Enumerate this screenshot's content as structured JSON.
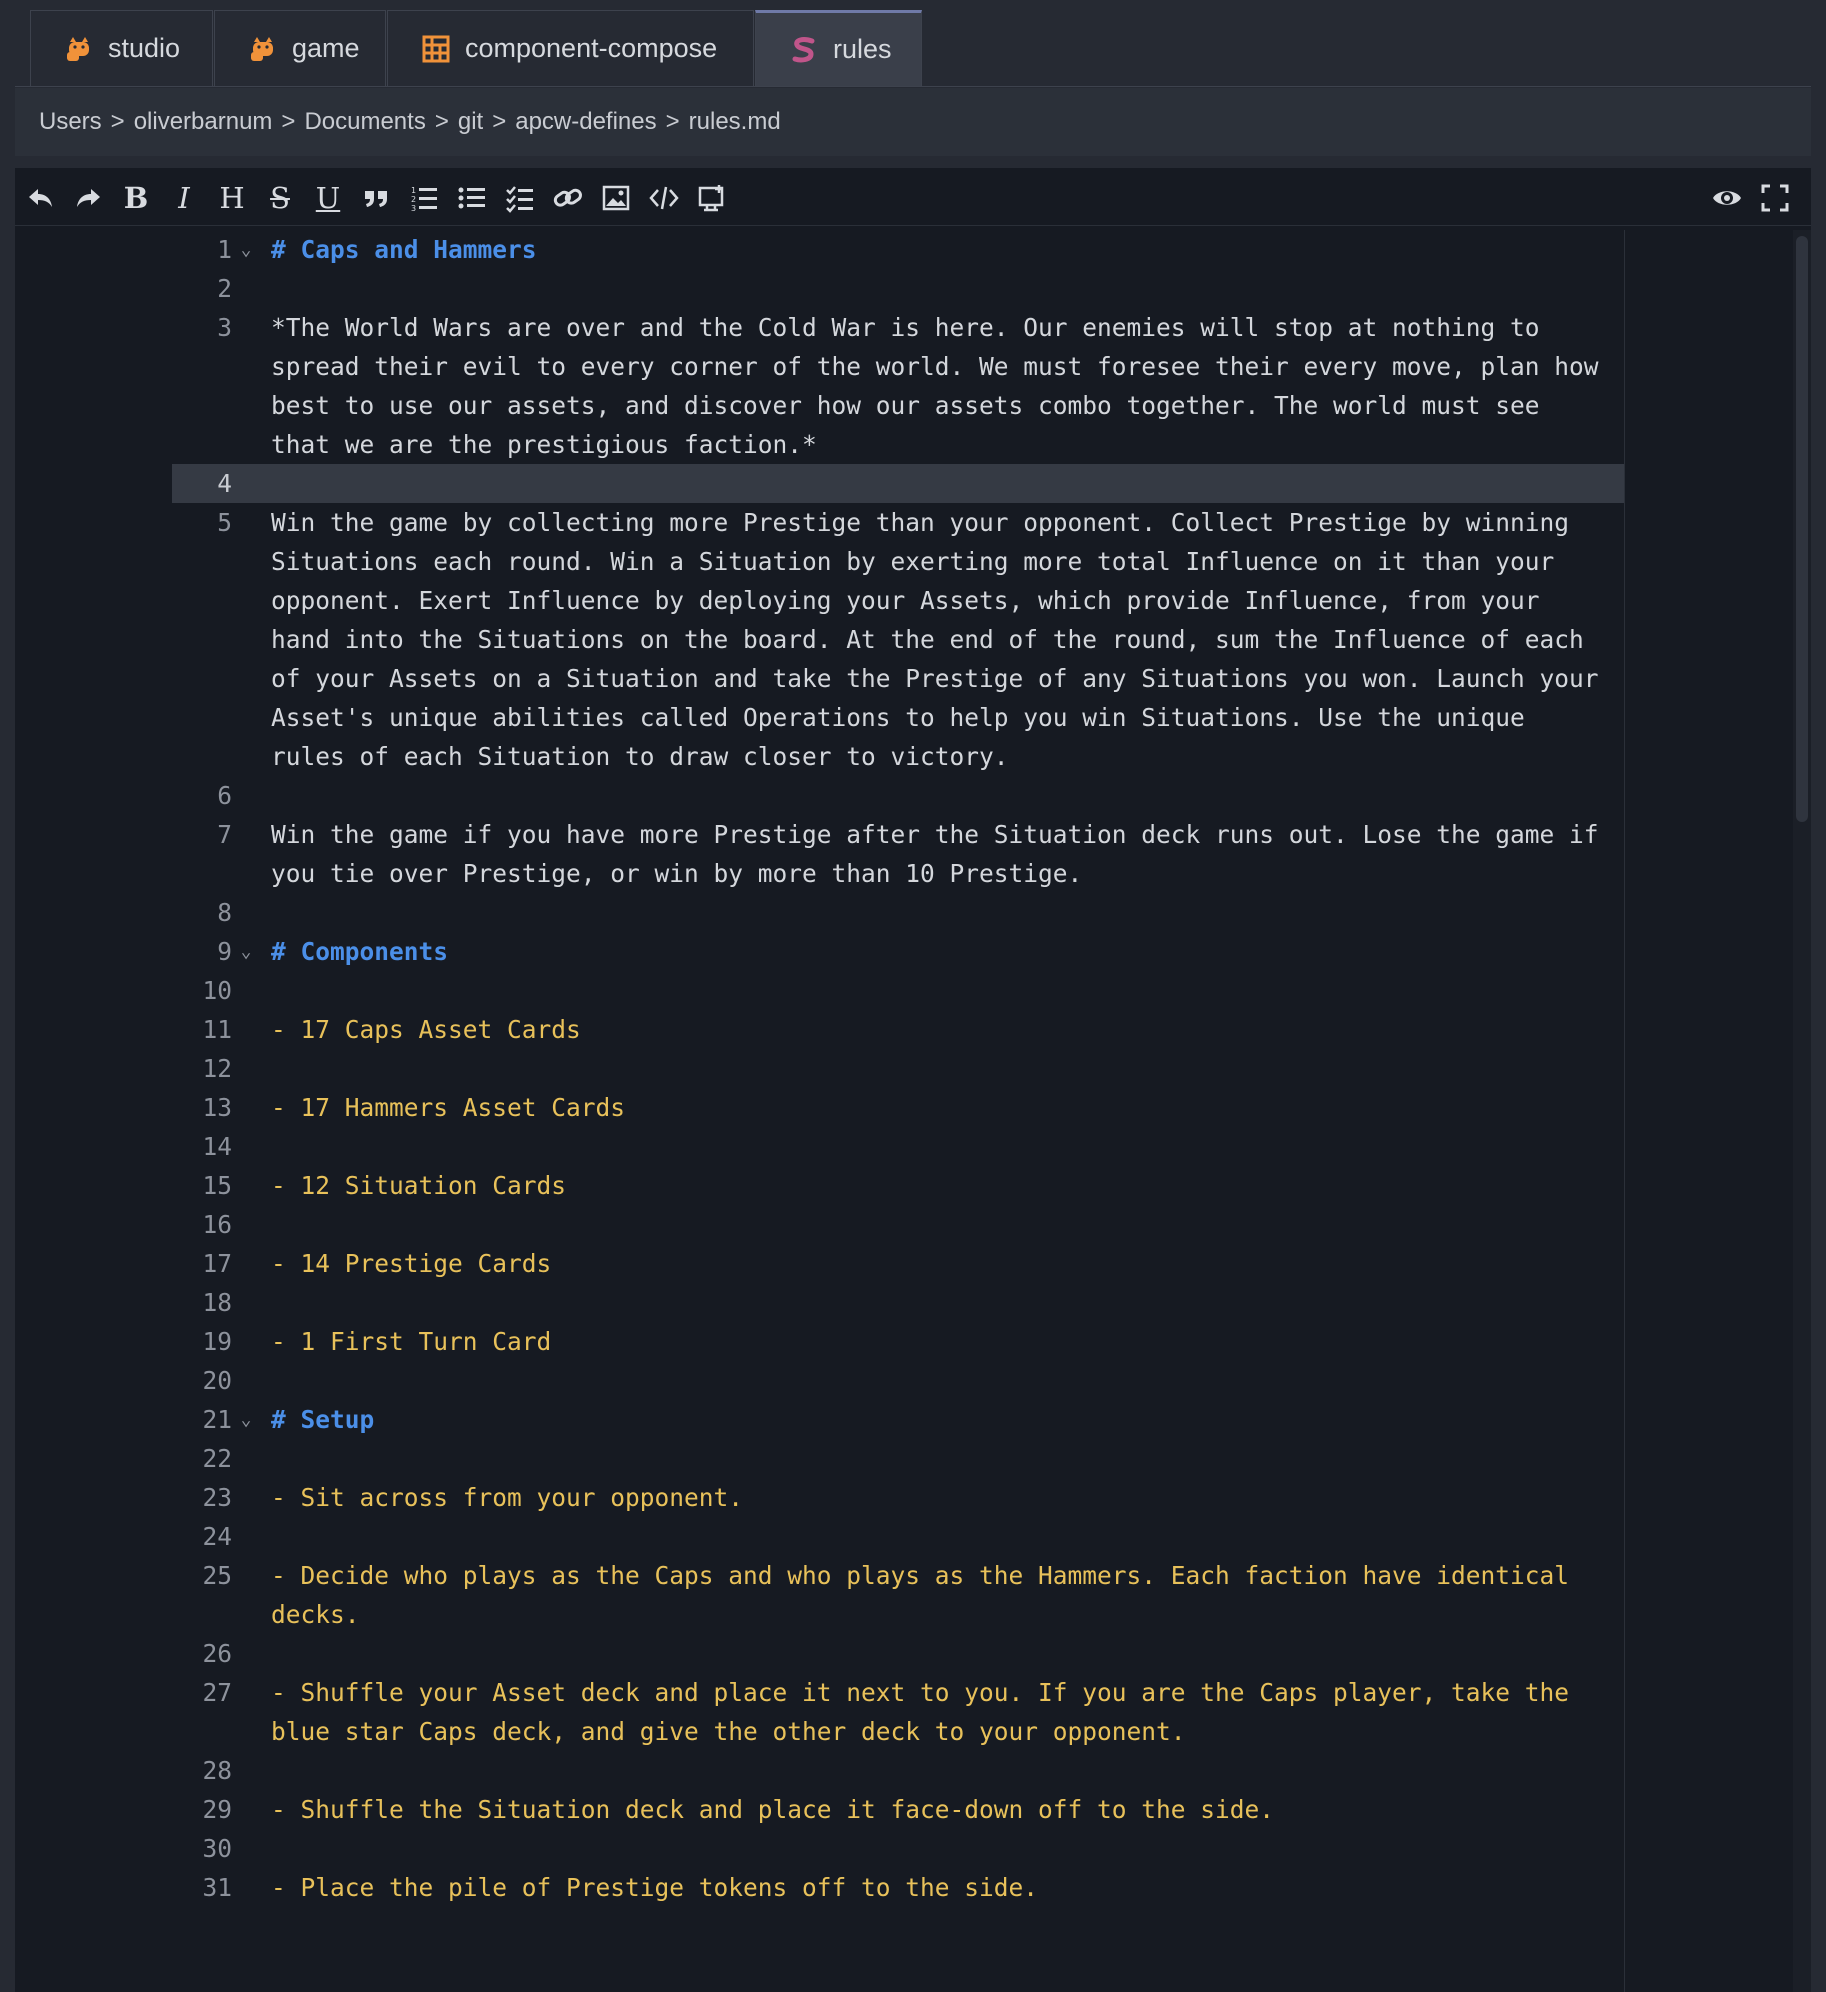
{
  "tabs": [
    {
      "label": "studio",
      "icon": "cat-icon",
      "active": false
    },
    {
      "label": "game",
      "icon": "cat-icon",
      "active": false
    },
    {
      "label": "component-compose",
      "icon": "grid-icon",
      "active": false
    },
    {
      "label": "rules",
      "icon": "markdown-s-icon",
      "active": true
    }
  ],
  "breadcrumb": {
    "parts": [
      "Users",
      "oliverbarnum",
      "Documents",
      "git",
      "apcw-defines",
      "rules.md"
    ],
    "separator": ">"
  },
  "toolbar": {
    "buttons": [
      "undo-icon",
      "redo-icon",
      "bold-icon",
      "italic-icon",
      "heading-icon",
      "strikethrough-icon",
      "underline-icon",
      "quote-icon",
      "ordered-list-icon",
      "unordered-list-icon",
      "checklist-icon",
      "link-icon",
      "image-icon",
      "code-icon",
      "table-icon"
    ],
    "right_buttons": [
      "preview-icon",
      "fullscreen-icon"
    ]
  },
  "editor": {
    "active_line": 4,
    "lines": [
      {
        "n": "1",
        "text": "# Caps and Hammers",
        "kind": "h",
        "fold": true
      },
      {
        "n": "2",
        "text": "",
        "kind": "t"
      },
      {
        "n": "3",
        "text": "*The World Wars are over and the Cold War is here. Our enemies will stop at nothing to spread their evil to every corner of the world. We must foresee their every move, plan how best to use our assets, and discover how our assets combo together. The world must see that we are the prestigious faction.*",
        "kind": "t"
      },
      {
        "n": "4",
        "text": "",
        "kind": "t"
      },
      {
        "n": "5",
        "text": "Win the game by collecting more Prestige than your opponent. Collect Prestige by winning Situations each round. Win a Situation by exerting more total Influence on it than your opponent. Exert Influence by deploying your Assets, which provide Influence, from your hand into the Situations on the board. At the end of the round, sum the Influence of each of your Assets on a Situation and take the Prestige of any Situations you won. Launch your Asset's unique abilities called Operations to help you win Situations. Use the unique rules of each Situation to draw closer to victory.",
        "kind": "t"
      },
      {
        "n": "6",
        "text": "",
        "kind": "t"
      },
      {
        "n": "7",
        "text": "Win the game if you have more Prestige after the Situation deck runs out. Lose the game if you tie over Prestige, or win by more than 10 Prestige.",
        "kind": "t"
      },
      {
        "n": "8",
        "text": "",
        "kind": "t"
      },
      {
        "n": "9",
        "text": "# Components",
        "kind": "h",
        "fold": true
      },
      {
        "n": "10",
        "text": "",
        "kind": "t"
      },
      {
        "n": "11",
        "text": "- 17 Caps Asset Cards",
        "kind": "li"
      },
      {
        "n": "12",
        "text": "",
        "kind": "t"
      },
      {
        "n": "13",
        "text": "- 17 Hammers Asset Cards",
        "kind": "li"
      },
      {
        "n": "14",
        "text": "",
        "kind": "t"
      },
      {
        "n": "15",
        "text": "- 12 Situation Cards",
        "kind": "li"
      },
      {
        "n": "16",
        "text": "",
        "kind": "t"
      },
      {
        "n": "17",
        "text": "- 14 Prestige Cards",
        "kind": "li"
      },
      {
        "n": "18",
        "text": "",
        "kind": "t"
      },
      {
        "n": "19",
        "text": "- 1 First Turn Card",
        "kind": "li"
      },
      {
        "n": "20",
        "text": "",
        "kind": "t"
      },
      {
        "n": "21",
        "text": "# Setup",
        "kind": "h",
        "fold": true
      },
      {
        "n": "22",
        "text": "",
        "kind": "t"
      },
      {
        "n": "23",
        "text": "- Sit across from your opponent.",
        "kind": "li"
      },
      {
        "n": "24",
        "text": "",
        "kind": "t"
      },
      {
        "n": "25",
        "text": "- Decide who plays as the Caps and who plays as the Hammers. Each faction have identical decks.",
        "kind": "li"
      },
      {
        "n": "26",
        "text": "",
        "kind": "t"
      },
      {
        "n": "27",
        "text": "- Shuffle your Asset deck and place it next to you. If you are the Caps player, take the blue star Caps deck, and give the other deck to your opponent.",
        "kind": "li"
      },
      {
        "n": "28",
        "text": "",
        "kind": "t"
      },
      {
        "n": "29",
        "text": "- Shuffle the Situation deck and place it face-down off to the side.",
        "kind": "li"
      },
      {
        "n": "30",
        "text": "",
        "kind": "t"
      },
      {
        "n": "31",
        "text": "- Place the pile of Prestige tokens off to the side.",
        "kind": "li"
      }
    ]
  },
  "colors": {
    "heading": "#4b8fe8",
    "list": "#e8c15a",
    "text": "#d4d7dc",
    "tab_icon_orange": "#f0923a",
    "tab_icon_pink": "#c0558a"
  }
}
